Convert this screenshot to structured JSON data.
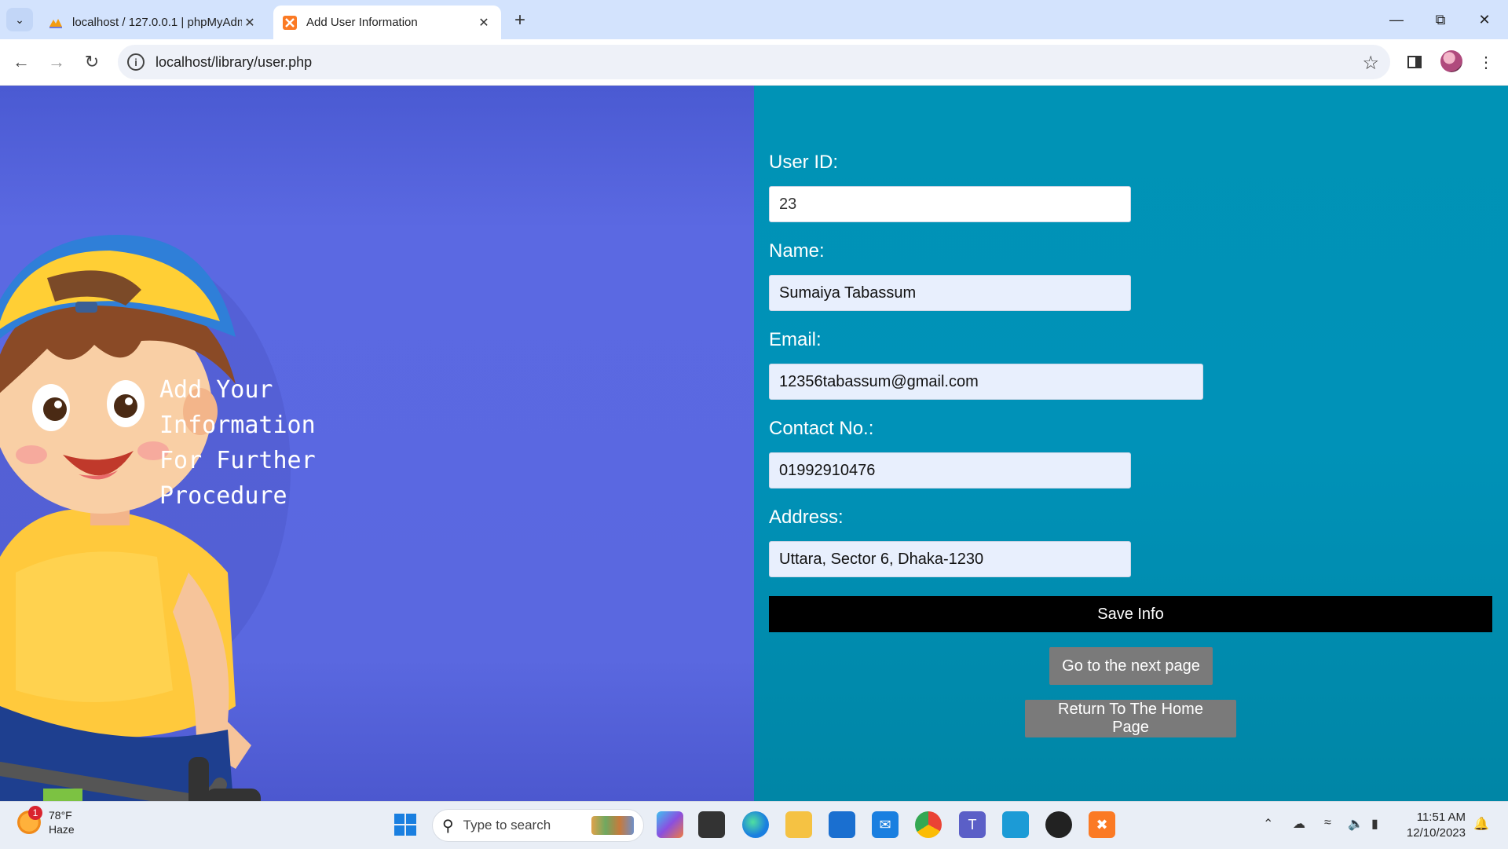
{
  "browser": {
    "tabs": [
      {
        "title": "localhost / 127.0.0.1 | phpMyAdmin",
        "active": false
      },
      {
        "title": "Add User Information",
        "active": true
      }
    ],
    "url": "localhost/library/user.php"
  },
  "hero": {
    "lines": [
      "Add Your",
      "Information",
      "For Further",
      "Procedure"
    ]
  },
  "form": {
    "user_id": {
      "label": "User ID:",
      "value": "23"
    },
    "name": {
      "label": "Name:",
      "value": "Sumaiya Tabassum"
    },
    "email": {
      "label": "Email:",
      "value": "12356tabassum@gmail.com"
    },
    "contact": {
      "label": "Contact No.:",
      "value": "01992910476"
    },
    "address": {
      "label": "Address:",
      "value": "Uttara, Sector 6, Dhaka-1230"
    },
    "save_label": "Save Info",
    "next_label": "Go to the next page",
    "home_label": "Return To The Home Page"
  },
  "taskbar": {
    "weather_temp": "78°F",
    "weather_desc": "Haze",
    "weather_badge": "1",
    "search_placeholder": "Type to search",
    "time": "11:51 AM",
    "date": "12/10/2023"
  },
  "colors": {
    "left_panel": "#5a68e0",
    "right_panel": "#0093b6",
    "save_button": "#000000",
    "grey_button": "#7a7a7a"
  }
}
